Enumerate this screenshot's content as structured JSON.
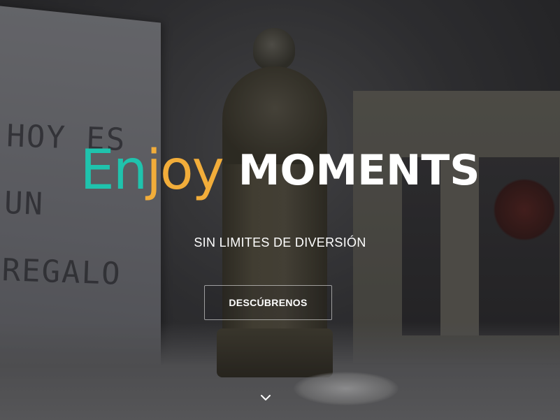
{
  "hero": {
    "logo": {
      "part1": "En",
      "part2": "joy",
      "color_part1": "#1fc3ad",
      "color_part2": "#f2ad3a"
    },
    "title": "MOMENTS",
    "subtitle": "SIN LIMITES DE DIVERSIÓN",
    "cta_label": "DESCÚBRENOS",
    "scroll_icon": "chevron-down-icon",
    "background_card_text": "HOY ES\nUN\nREGALO"
  }
}
